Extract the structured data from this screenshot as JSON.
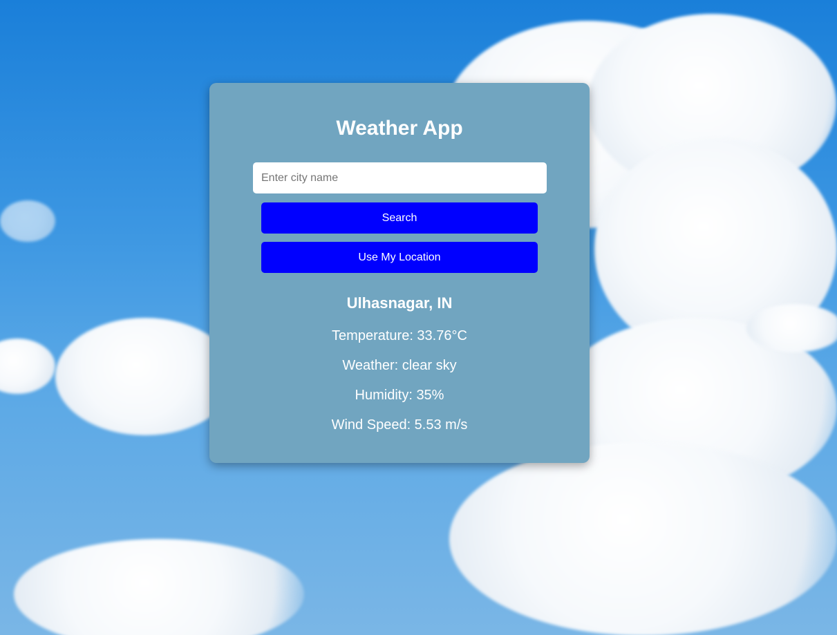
{
  "app": {
    "title": "Weather App"
  },
  "search": {
    "placeholder": "Enter city name",
    "value": "",
    "search_label": "Search",
    "location_label": "Use My Location"
  },
  "result": {
    "city": "Ulhasnagar, IN",
    "temperature": "Temperature: 33.76°C",
    "weather": "Weather: clear sky",
    "humidity": "Humidity: 35%",
    "wind": "Wind Speed: 5.53 m/s"
  },
  "colors": {
    "card_background": "#71a5c0",
    "button_background": "#0000ff",
    "text": "#ffffff",
    "sky": "#1a7fd9"
  }
}
